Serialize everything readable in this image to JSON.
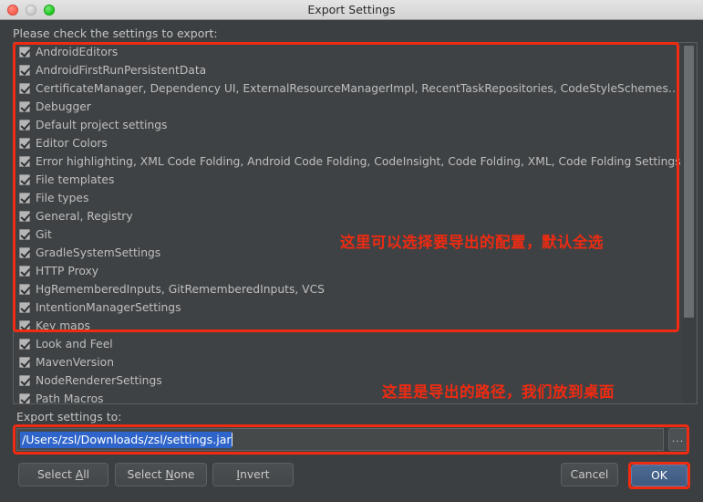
{
  "window": {
    "title": "Export Settings",
    "traffic_lights": [
      "close-button",
      "minimize-button",
      "zoom-button"
    ]
  },
  "prompt": "Please check the settings to export:",
  "settings_list": {
    "items": [
      {
        "label": "AndroidEditors",
        "checked": true
      },
      {
        "label": "AndroidFirstRunPersistentData",
        "checked": true
      },
      {
        "label": "CertificateManager, Dependency UI, ExternalResourceManagerImpl, RecentTaskRepositories, CodeStyleSchemesUIConfig...",
        "checked": true
      },
      {
        "label": "Debugger",
        "checked": true
      },
      {
        "label": "Default project settings",
        "checked": true
      },
      {
        "label": "Editor Colors",
        "checked": true
      },
      {
        "label": "Error highlighting, XML Code Folding, Android Code Folding, CodeInsight, Code Folding, XML, Code Folding Settings",
        "checked": true
      },
      {
        "label": "File templates",
        "checked": true
      },
      {
        "label": "File types",
        "checked": true
      },
      {
        "label": "General, Registry",
        "checked": true
      },
      {
        "label": "Git",
        "checked": true
      },
      {
        "label": "GradleSystemSettings",
        "checked": true
      },
      {
        "label": "HTTP Proxy",
        "checked": true
      },
      {
        "label": "HgRememberedInputs, GitRememberedInputs, VCS",
        "checked": true
      },
      {
        "label": "IntentionManagerSettings",
        "checked": true
      },
      {
        "label": "Key maps",
        "checked": true
      },
      {
        "label": "Look and Feel",
        "checked": true
      },
      {
        "label": "MavenVersion",
        "checked": true
      },
      {
        "label": "NodeRendererSettings",
        "checked": true
      },
      {
        "label": "Path Macros",
        "checked": true
      }
    ]
  },
  "export_path": {
    "label": "Export settings to:",
    "value": "/Users/zsl/Downloads/zsl/settings.jar",
    "browse_label": "..."
  },
  "buttons": {
    "select_all": {
      "pre": "Select ",
      "mnemonic": "A",
      "post": "ll"
    },
    "select_none": {
      "pre": "Select ",
      "mnemonic": "N",
      "post": "one"
    },
    "invert": {
      "pre": "",
      "mnemonic": "I",
      "post": "nvert"
    },
    "cancel": "Cancel",
    "ok": "OK"
  },
  "annotations": [
    {
      "text": "这里可以选择要导出的配置，默认全选",
      "color": "#ee2b12"
    },
    {
      "text": "这里是导出的路径，我们放到桌面",
      "color": "#ee2b12"
    }
  ],
  "colors": {
    "window_bg": "#3c3f41",
    "list_bg": "#3f4244",
    "text": "#bfbfbf",
    "annotation_red": "#ee2b12",
    "selection_blue": "#2f65ca",
    "ok_button_blue": "#45638c"
  }
}
